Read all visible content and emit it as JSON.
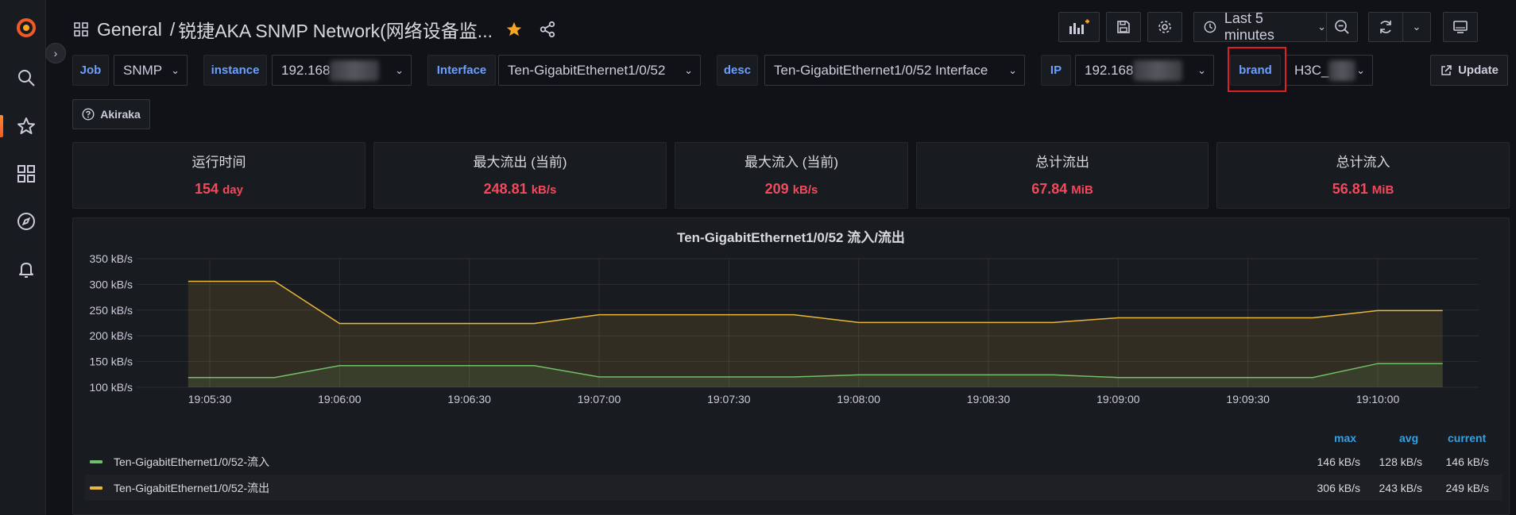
{
  "nav": {
    "breadcrumb_root": "General",
    "separator": "/",
    "dashboard_title": "锐捷AKA SNMP Network(网络设备监...",
    "time_range": "Last 5 minutes"
  },
  "variables": [
    {
      "label": "Job",
      "value": "SNMP"
    },
    {
      "label": "instance",
      "value": "192.168"
    },
    {
      "label": "Interface",
      "value": "Ten-GigabitEthernet1/0/52"
    },
    {
      "label": "desc",
      "value": "Ten-GigabitEthernet1/0/52 Interface"
    },
    {
      "label": "IP",
      "value": "192.168"
    },
    {
      "label": "brand",
      "value": "H3C_"
    }
  ],
  "update_label": "Update",
  "link_label": "Akiraka",
  "stats": [
    {
      "title": "运行时间",
      "value": "154",
      "unit": "day"
    },
    {
      "title": "最大流出 (当前)",
      "value": "248.81",
      "unit": "kB/s"
    },
    {
      "title": "最大流入 (当前)",
      "value": "209",
      "unit": "kB/s"
    },
    {
      "title": "总计流出",
      "value": "67.84",
      "unit": "MiB"
    },
    {
      "title": "总计流入",
      "value": "56.81",
      "unit": "MiB"
    }
  ],
  "colors": {
    "accent": "#f05a28",
    "stat_value": "#f2495c",
    "var_label": "#6e9fff",
    "legend_header": "#33a2e5",
    "series_in": "#73bf69",
    "series_out": "#eab839"
  },
  "graph": {
    "title": "Ten-GigabitEthernet1/0/52 流入/流出",
    "legend_headers": [
      "max",
      "avg",
      "current"
    ],
    "legend": [
      {
        "name": "Ten-GigabitEthernet1/0/52-流入",
        "max": "146 kB/s",
        "avg": "128 kB/s",
        "current": "146 kB/s"
      },
      {
        "name": "Ten-GigabitEthernet1/0/52-流出",
        "max": "306 kB/s",
        "avg": "243 kB/s",
        "current": "249 kB/s"
      }
    ]
  },
  "chart_data": {
    "type": "area",
    "title": "Ten-GigabitEthernet1/0/52 流入/流出",
    "x_ticks": [
      "19:05:30",
      "19:06:00",
      "19:06:30",
      "19:07:00",
      "19:07:30",
      "19:08:00",
      "19:08:30",
      "19:09:00",
      "19:09:30",
      "19:10:00"
    ],
    "y_ticks": [
      "100 kB/s",
      "150 kB/s",
      "200 kB/s",
      "250 kB/s",
      "300 kB/s",
      "350 kB/s"
    ],
    "ylim": [
      100,
      350
    ],
    "grid": true,
    "x": [
      "19:05:25",
      "19:05:45",
      "19:06:00",
      "19:06:45",
      "19:07:00",
      "19:07:45",
      "19:08:00",
      "19:08:45",
      "19:09:00",
      "19:09:45",
      "19:10:00",
      "19:10:15"
    ],
    "series": [
      {
        "name": "Ten-GigabitEthernet1/0/52-流入",
        "values": [
          119,
          119,
          142,
          142,
          120,
          120,
          124,
          124,
          119,
          119,
          146,
          146
        ]
      },
      {
        "name": "Ten-GigabitEthernet1/0/52-流出",
        "values": [
          306,
          306,
          224,
          224,
          241,
          241,
          226,
          226,
          235,
          235,
          249,
          249
        ]
      }
    ]
  }
}
